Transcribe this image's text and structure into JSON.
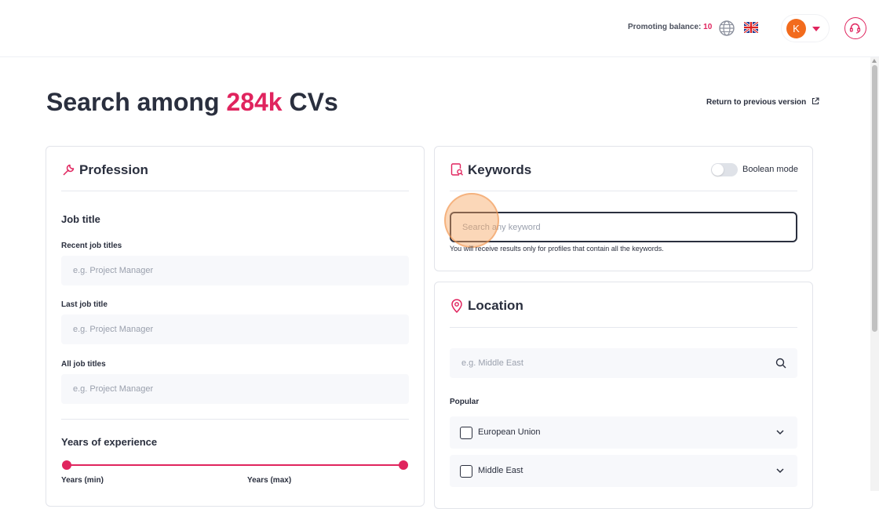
{
  "header": {
    "promoting_label": "Promoting balance:",
    "promoting_value": "10",
    "avatar_initial": "K"
  },
  "page": {
    "title_prefix": "Search among ",
    "title_highlight": "284k",
    "title_suffix": " CVs",
    "return_link": "Return to previous version"
  },
  "profession": {
    "title": "Profession",
    "job_title_heading": "Job title",
    "fields": [
      {
        "label": "Recent job titles",
        "placeholder": "e.g. Project Manager"
      },
      {
        "label": "Last job title",
        "placeholder": "e.g. Project Manager"
      },
      {
        "label": "All job titles",
        "placeholder": "e.g. Project Manager"
      }
    ],
    "experience_heading": "Years of experience",
    "years_min_label": "Years (min)",
    "years_max_label": "Years (max)"
  },
  "keywords": {
    "title": "Keywords",
    "boolean_label": "Boolean mode",
    "boolean_on": false,
    "placeholder": "Search any keyword",
    "hint": "You will receive results only for profiles that contain all the keywords."
  },
  "location": {
    "title": "Location",
    "placeholder": "e.g. Middle East",
    "popular_heading": "Popular",
    "popular": [
      {
        "label": "European Union"
      },
      {
        "label": "Middle East"
      }
    ]
  },
  "colors": {
    "accent": "#e0245e",
    "text": "#2a2f3e",
    "avatar": "#f26b1d"
  }
}
